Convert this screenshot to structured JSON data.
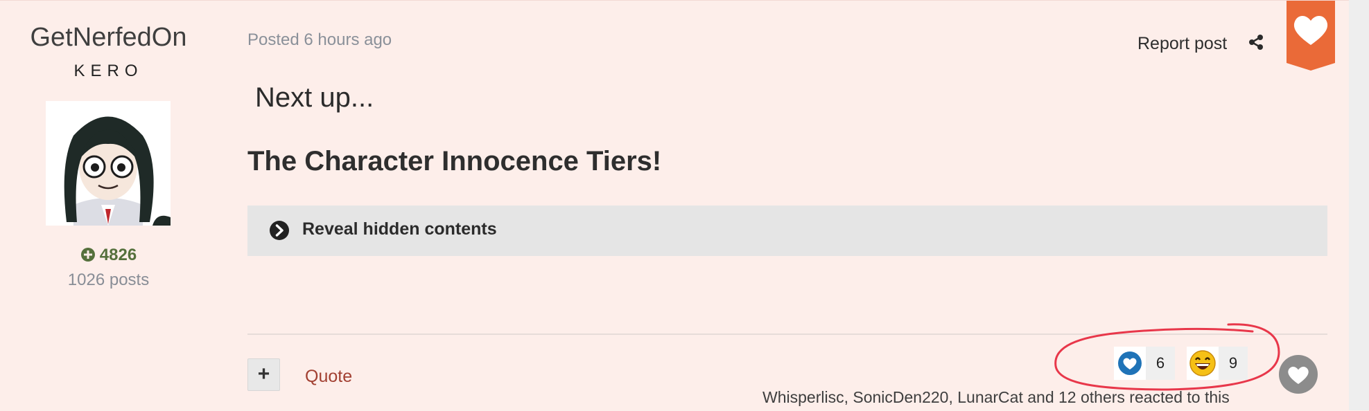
{
  "author": {
    "name": "GetNerfedOn",
    "title": "KERO",
    "reputation": "4826",
    "posts": "1026 posts",
    "avatar_icon": "frog-girl-avatar"
  },
  "post": {
    "posted": "Posted 6 hours ago",
    "report": "Report post",
    "content_line": "Next up...",
    "content_heading": "The Character Innocence Tiers!",
    "spoiler_label": "Reveal hidden contents"
  },
  "footer": {
    "plus": "+",
    "quote": "Quote",
    "reactions": [
      {
        "icon": "heart-reaction-icon",
        "count": "6"
      },
      {
        "icon": "laugh-reaction-icon",
        "count": "9"
      }
    ],
    "reacted_text": "Whisperlisc, SonicDen220, LunarCat and 12 others reacted to this"
  },
  "colors": {
    "background": "#fdeeea",
    "accent": "#ea6a38",
    "reputation": "#55703c",
    "quote": "#a24032",
    "annotation": "#e8374a"
  }
}
